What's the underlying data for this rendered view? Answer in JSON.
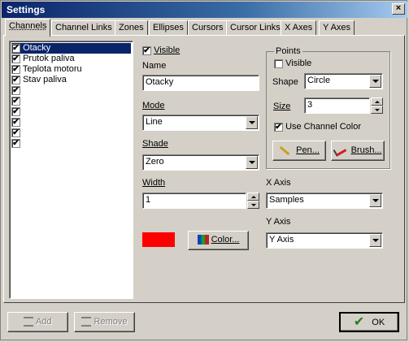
{
  "window": {
    "title": "Settings",
    "close_glyph": "×"
  },
  "tabs": [
    {
      "label": "Channels"
    },
    {
      "label": "Channel Links"
    },
    {
      "label": "Zones"
    },
    {
      "label": "Ellipses"
    },
    {
      "label": "Cursors"
    },
    {
      "label": "Cursor Links"
    },
    {
      "label": "X Axes"
    },
    {
      "label": "Y Axes"
    }
  ],
  "channel_list": [
    {
      "label": "Otacky",
      "checked": true,
      "selected": true
    },
    {
      "label": "Prutok paliva",
      "checked": true
    },
    {
      "label": "Teplota motoru",
      "checked": true
    },
    {
      "label": "Stav paliva",
      "checked": true
    },
    {
      "label": "",
      "checked": true
    },
    {
      "label": "",
      "checked": true
    },
    {
      "label": "",
      "checked": true
    },
    {
      "label": "",
      "checked": true
    },
    {
      "label": "",
      "checked": true
    },
    {
      "label": "",
      "checked": true
    }
  ],
  "channel": {
    "visible_label": "Visible",
    "name_label": "Name",
    "name_value": "Otacky",
    "mode_label": "Mode",
    "mode_value": "Line",
    "shade_label": "Shade",
    "shade_value": "Zero",
    "width_label": "Width",
    "width_value": "1",
    "color_swatch": "#ff0000",
    "color_button": "Color..."
  },
  "points": {
    "group_label": "Points",
    "visible_label": "Visible",
    "shape_label": "Shape",
    "shape_value": "Circle",
    "size_label": "Size",
    "size_value": "3",
    "use_channel_color_label": "Use Channel Color",
    "pen_button": "Pen...",
    "brush_button": "Brush..."
  },
  "axes": {
    "x_axis_label": "X Axis",
    "x_axis_value": "Samples",
    "y_axis_label": "Y Axis",
    "y_axis_value": "Y Axis"
  },
  "footer": {
    "add_button": "Add",
    "remove_button": "Remove",
    "ok_button": "OK"
  },
  "check_glyph": "✔"
}
